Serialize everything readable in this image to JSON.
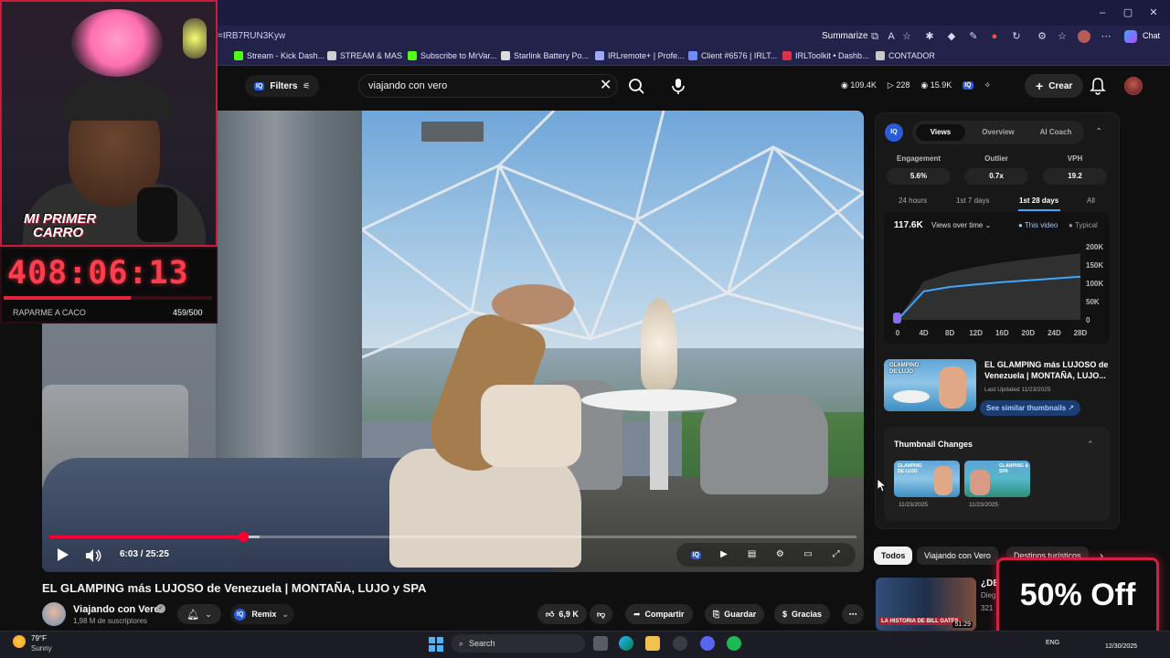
{
  "browser": {
    "url_fragment": "=IRB7RUN3Kyw",
    "summarize_label": "Summarize",
    "chat_label": "Chat",
    "bookmarks": [
      {
        "label": "Stream - Kick Dash...",
        "color": "#53fc18"
      },
      {
        "label": "STREAM & MAS",
        "color": "#cfcfcf"
      },
      {
        "label": "Subscribe to MrVar...",
        "color": "#53fc18"
      },
      {
        "label": "Starlink Battery Po...",
        "color": "#dcdcdc"
      },
      {
        "label": "IRLremote+ | Profe...",
        "color": "#9ea6ff"
      },
      {
        "label": "Client #6576 | IRLT...",
        "color": "#6d8dff"
      },
      {
        "label": "IRLToolkit • Dashb...",
        "color": "#e0314b"
      },
      {
        "label": "CONTADOR",
        "color": "#c9c9c9"
      }
    ]
  },
  "header": {
    "filters_label": "Filters",
    "search_value": "viajando con vero",
    "stats": {
      "views": "109.4K",
      "videos": "228",
      "likes": "15.9K"
    },
    "crear_label": "Crear"
  },
  "player": {
    "progress_fraction": 0.24,
    "buffer_fraction": 0.26,
    "time": "6:03 / 25:25"
  },
  "video": {
    "title": "EL GLAMPING más LUJOSO de Venezuela | MONTAÑA, LUJO y SPA",
    "channel": "Viajando con Vero",
    "subscribers": "1,98 M de suscriptores",
    "remix_label": "Remix",
    "likes": "6,9 K",
    "share_label": "Compartir",
    "save_label": "Guardar",
    "thanks_label": "Gracias"
  },
  "panel": {
    "logo": "IQ",
    "tabs": [
      "Views",
      "Overview",
      "AI Coach"
    ],
    "active_tab": "Views",
    "metrics": [
      {
        "label": "Engagement",
        "value": "5.6%"
      },
      {
        "label": "Outlier",
        "value": "0.7x"
      },
      {
        "label": "VPH",
        "value": "19.2"
      }
    ],
    "ranges": [
      "24 hours",
      "1st 7 days",
      "1st 28 days",
      "All"
    ],
    "active_range": "1st 28 days",
    "views_total": "117.6K",
    "views_dropdown": "Views over time",
    "legend_this": "This video",
    "legend_typical": "Typical",
    "related_title": "EL GLAMPING más LUJOSO de Venezuela | MONTAÑA, LUJO...",
    "last_updated": "Last Updated 11/23/2025",
    "similar_label": "See similar thumbnails",
    "thumbnail_changes_title": "Thumbnail Changes",
    "thumbnail_changes": [
      {
        "date": "11/23/2025",
        "label": "GLAMPING DE LUJO"
      },
      {
        "date": "11/23/2025",
        "label": "GLAMPING & SPA"
      }
    ],
    "thumb_overlay": "GLAMPING DE LUJO"
  },
  "chart_data": {
    "type": "area",
    "x": [
      0,
      4,
      8,
      12,
      16,
      20,
      24,
      28
    ],
    "xticks": [
      "0",
      "4D",
      "8D",
      "12D",
      "16D",
      "20D",
      "24D",
      "28D"
    ],
    "yticks": [
      "0",
      "50K",
      "100K",
      "150K",
      "200K"
    ],
    "ylim": [
      0,
      200000
    ],
    "series": [
      {
        "name": "This video",
        "values": [
          0,
          78000,
          90000,
          97000,
          103000,
          108000,
          113000,
          118000
        ],
        "color": "#3ea6ff"
      },
      {
        "name": "Typical",
        "values": [
          0,
          105000,
          130000,
          145000,
          157000,
          166000,
          174000,
          182000
        ],
        "color": "#444444"
      }
    ]
  },
  "chips": [
    "Todos",
    "Viajando con Vero",
    "Destinos turísticos"
  ],
  "recommended": {
    "title": "¿DE",
    "channel": "Dieg",
    "views": "321",
    "duration": "51:29",
    "overlay_text": "LA HISTORIA DE BILL GATES"
  },
  "promo": {
    "text": "50% Off"
  },
  "webcam": {
    "car_text_line1": "MI PRIMER",
    "car_text_line2": "CARRO"
  },
  "timer": {
    "digits": "408:06:13",
    "goal_label": "RAPARME A CACO",
    "goal_count": "459/500",
    "goal_fraction": 0.61
  },
  "taskbar": {
    "temp": "79°F",
    "condition": "Sunny",
    "search_label": "Search",
    "lang": "ENG",
    "date": "12/30/2025"
  },
  "colors": {
    "accent_red": "#ff0033",
    "iq_blue": "#2b5bd7",
    "chart_blue": "#3ea6ff",
    "timer_red": "#ff3e4d"
  }
}
